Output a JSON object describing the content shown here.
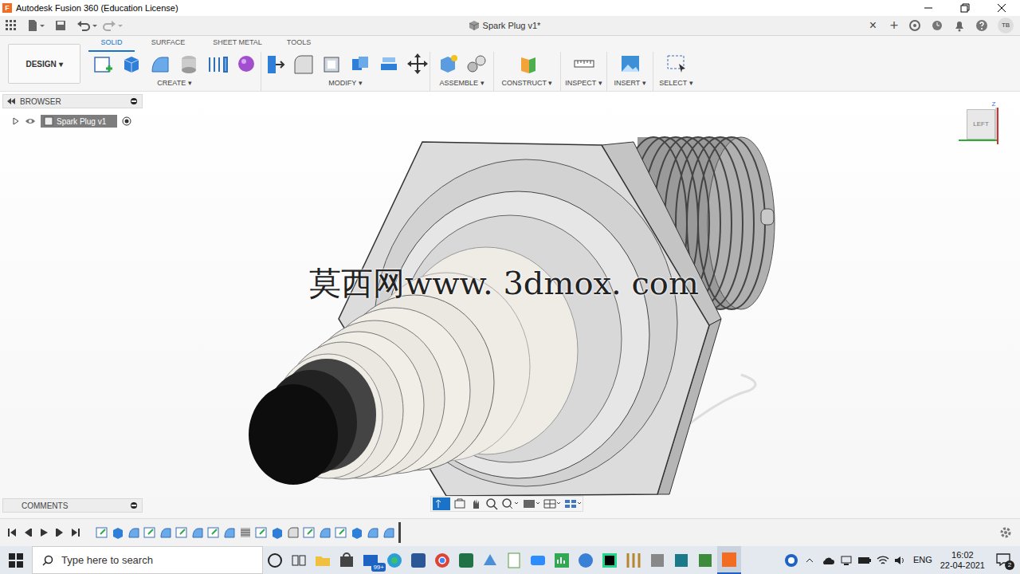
{
  "window": {
    "title": "Autodesk Fusion 360 (Education License)",
    "logo": "F"
  },
  "document_tab": {
    "title": "Spark Plug v1*",
    "close": "×",
    "new_tab": "+"
  },
  "user": {
    "initials": "TB"
  },
  "workspace": {
    "label": "DESIGN ▾"
  },
  "toolbar_tabs": [
    {
      "label": "SOLID",
      "selected": true
    },
    {
      "label": "SURFACE",
      "selected": false
    },
    {
      "label": "SHEET METAL",
      "selected": false
    },
    {
      "label": "TOOLS",
      "selected": false
    }
  ],
  "toolbar_groups": [
    "CREATE ▾",
    "MODIFY ▾",
    "ASSEMBLE ▾",
    "CONSTRUCT ▾",
    "INSPECT ▾",
    "INSERT ▾",
    "SELECT ▾"
  ],
  "browser": {
    "title": "BROWSER",
    "items": [
      {
        "label": "Spark Plug v1",
        "expanded": false,
        "visible": true,
        "active": true
      }
    ]
  },
  "comments": {
    "title": "COMMENTS"
  },
  "viewcube": {
    "face": "LEFT",
    "axis": "Z"
  },
  "watermark": "莫西网www. 3dmox. com",
  "timeline": {
    "features": [
      "sketch",
      "extrude",
      "revolve",
      "sketch",
      "revolve",
      "sketch",
      "revolve",
      "sketch",
      "revolve",
      "thread",
      "sketch",
      "extrude",
      "fillet",
      "sketch",
      "revolve",
      "sketch",
      "extrude",
      "revolve",
      "revolve"
    ]
  },
  "taskbar": {
    "search_placeholder": "Type here to search",
    "badge": "99+",
    "language": "ENG",
    "time": "16:02",
    "date": "22-04-2021",
    "notifications": "2"
  }
}
